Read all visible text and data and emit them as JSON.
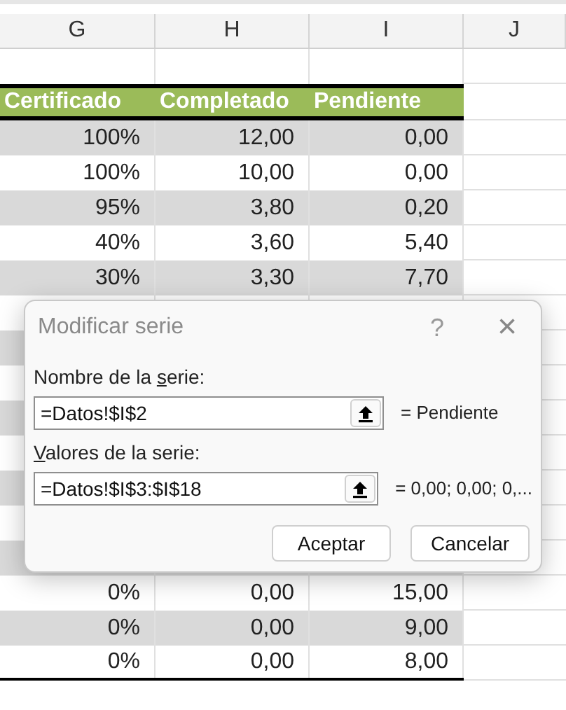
{
  "column_headers": [
    {
      "label": "G"
    },
    {
      "label": "H"
    },
    {
      "label": "I"
    },
    {
      "label": "J"
    }
  ],
  "table": {
    "columns": [
      "Certificado",
      "Completado",
      "Pendiente"
    ],
    "rows_above": [
      {
        "shaded": true,
        "cells": [
          "100%",
          "12,00",
          "0,00"
        ]
      },
      {
        "shaded": false,
        "cells": [
          "100%",
          "10,00",
          "0,00"
        ]
      },
      {
        "shaded": true,
        "cells": [
          "95%",
          "3,80",
          "0,20"
        ]
      },
      {
        "shaded": false,
        "cells": [
          "40%",
          "3,60",
          "5,40"
        ]
      },
      {
        "shaded": true,
        "cells": [
          "30%",
          "3,30",
          "7,70"
        ]
      }
    ],
    "rows_below": [
      {
        "shaded": false,
        "cells": [
          "0%",
          "0,00",
          "15,00"
        ]
      },
      {
        "shaded": true,
        "cells": [
          "0%",
          "0,00",
          "9,00"
        ]
      },
      {
        "shaded": false,
        "cells": [
          "0%",
          "0,00",
          "8,00"
        ]
      }
    ]
  },
  "dialog": {
    "title": "Modificar serie",
    "help": "?",
    "close": "×",
    "fields": [
      {
        "label": {
          "before": "Nombre de la ",
          "key": "s",
          "after": "erie:"
        },
        "value": "=Datos!$I$2",
        "result": "= Pendiente"
      },
      {
        "label": {
          "key": "V",
          "after": "alores de la serie:"
        },
        "value": "=Datos!$I$3:$I$18",
        "result": "= 0,00; 0,00; 0,..."
      }
    ],
    "buttons": [
      "Aceptar",
      "Cancelar"
    ]
  }
}
